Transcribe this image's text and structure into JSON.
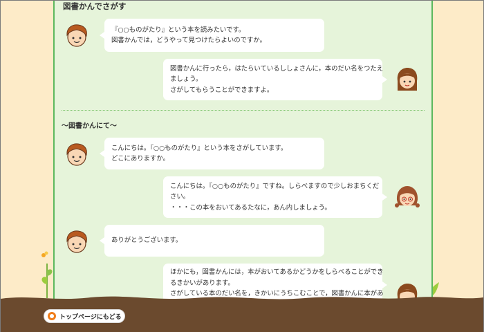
{
  "section": {
    "title": "図書かんでさがす"
  },
  "sub_section": {
    "title": "～図書かんにて～"
  },
  "conversations": [
    {
      "speaker": "boy",
      "lines": [
        "『○○ものがたり』という本を読みたいです。",
        "図書かんでは，どうやって見つけたらよいのですか。"
      ]
    },
    {
      "speaker": "woman",
      "lines": [
        "図書かんに行ったら，はたらいているししょさんに，本のだい名をつたえ",
        "ましょう。",
        "さがしてもらうことができますよ。"
      ]
    },
    {
      "speaker": "boy",
      "lines": [
        "こんにちは。『○○ものがたり』という本をさがしています。",
        "どこにありますか。"
      ]
    },
    {
      "speaker": "librarian",
      "lines": [
        "こんにちは。『○○ものがたり』ですね。しらべますので少しおまちくだ",
        "さい。",
        "・・・この本をおいてあるたなに，あん内しましょう。"
      ]
    },
    {
      "speaker": "boy",
      "lines": [
        "ありがとうございます。"
      ]
    },
    {
      "speaker": "woman",
      "lines": [
        "ほかにも，図書かんには，本がおいてあるかどうかをしらべることができ",
        "るきかいがあります。",
        "さがしている本のだい名を，きかいにうちこむことで，図書かんに本があ"
      ]
    }
  ],
  "footer": {
    "top_button_label": "トップページにもどる",
    "icon": "circle-arrow-icon"
  },
  "colors": {
    "panel": "#e6f4da",
    "border": "#5cb85c",
    "background": "#fdebc8",
    "ground": "#6b4a2e",
    "accent": "#f07d1a"
  }
}
